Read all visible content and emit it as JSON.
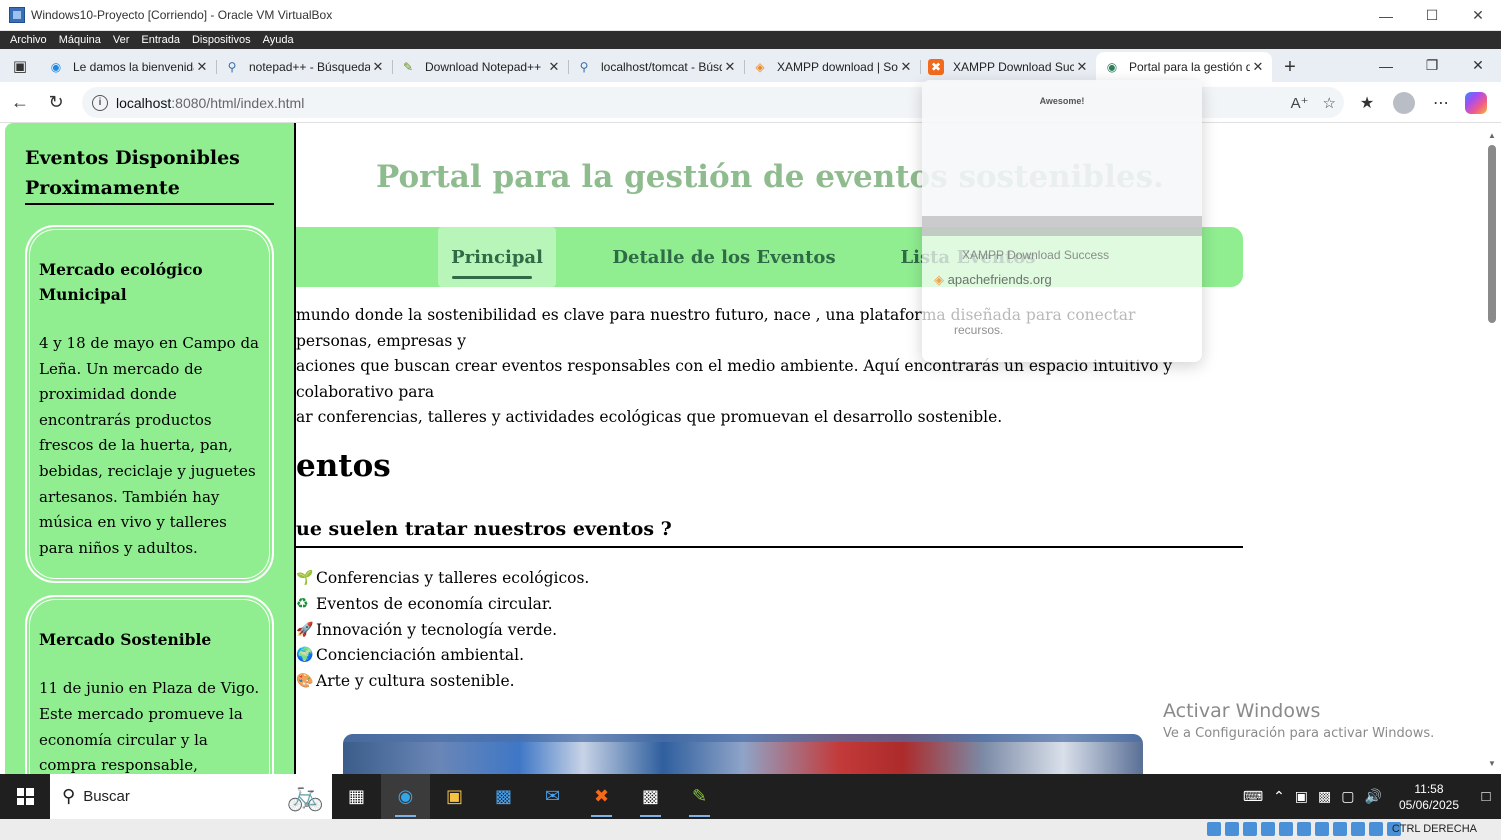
{
  "vbox": {
    "title": "Windows10-Proyecto [Corriendo] - Oracle VM VirtualBox",
    "menu": [
      "Archivo",
      "Máquina",
      "Ver",
      "Entrada",
      "Dispositivos",
      "Ayuda"
    ],
    "host_key": "CTRL DERECHA"
  },
  "browser": {
    "tabs": [
      {
        "title": "Le damos la bienvenida",
        "icon": "edge-icon"
      },
      {
        "title": "notepad++ - Búsqueda",
        "icon": "search-icon"
      },
      {
        "title": "Download Notepad++",
        "icon": "notepad-icon"
      },
      {
        "title": "localhost/tomcat - Búsqueda",
        "icon": "search-icon"
      },
      {
        "title": "XAMPP download | SourceForge",
        "icon": "xampp-icon"
      },
      {
        "title": "XAMPP Download Success",
        "icon": "xampp-icon"
      },
      {
        "title": "Portal para la gestión de eventos",
        "icon": "globe-icon",
        "active": true
      }
    ],
    "url_host": "localhost",
    "url_path": ":8080/html/index.html",
    "download_flyout": {
      "heading": "Awesome!",
      "item_title": "XAMPP Download Success",
      "item_source": "apachefriends.org",
      "item_sub": "recursos."
    }
  },
  "page": {
    "title": "Portal para la gestión de eventos sostenibles.",
    "nav": [
      {
        "label": "Principal",
        "active": true
      },
      {
        "label": "Detalle de los Eventos",
        "active": false
      },
      {
        "label": "Lista Eventos",
        "active": false
      }
    ],
    "intro_lines": [
      "mundo donde la sostenibilidad es clave para nuestro futuro, nace , una plataforma diseñada para conectar personas, empresas y",
      "aciones que buscan crear eventos responsables con el medio ambiente. Aquí encontrarás un espacio intuitivo y colaborativo para",
      "ar conferencias, talleres y actividades ecológicas que promuevan el desarrollo sostenible."
    ],
    "section_heading": "entos",
    "topics_heading": "ue suelen tratar nuestros eventos ?",
    "topics": [
      {
        "icon": "sprout-icon",
        "glyph": "🌱",
        "text": "Conferencias y talleres ecológicos."
      },
      {
        "icon": "recycle-icon",
        "glyph": "♻",
        "text": "Eventos de economía circular."
      },
      {
        "icon": "rocket-icon",
        "glyph": "🚀",
        "text": "Innovación y tecnología verde."
      },
      {
        "icon": "earth-icon",
        "glyph": "🌍",
        "text": "Concienciación ambiental."
      },
      {
        "icon": "art-icon",
        "glyph": "🎨",
        "text": "Arte y cultura sostenible."
      }
    ]
  },
  "sidebar": {
    "title": "Eventos Disponibles Proximamente",
    "events": [
      {
        "name": "Mercado ecológico Municipal",
        "description": "4 y 18 de mayo en Campo da Leña. Un mercado de proximidad donde encontrarás productos frescos de la huerta, pan, bebidas, reciclaje y juguetes artesanos. También hay música en vivo y talleres para niños y adultos."
      },
      {
        "name": "Mercado Sostenible",
        "description": "11 de junio en Plaza de Vigo. Este mercado promueve la economía circular y la compra responsable, aplicando la regla"
      }
    ]
  },
  "watermark": {
    "line1": "Activar Windows",
    "line2": "Ve a Configuración para activar Windows."
  },
  "taskbar": {
    "search_placeholder": "Buscar",
    "time": "11:58",
    "date": "05/06/2025"
  }
}
